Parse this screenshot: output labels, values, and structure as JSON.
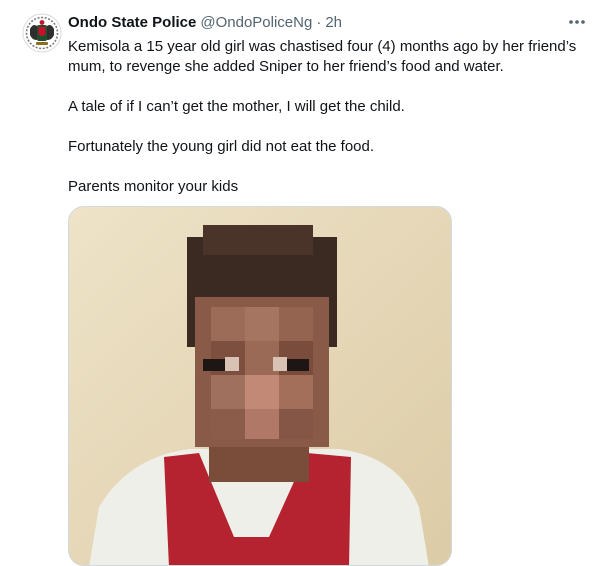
{
  "tweet": {
    "author_name": "Ondo State Police",
    "handle": "@OndoPoliceNg",
    "separator": "·",
    "time": "2h",
    "more_icon": "more-horizontal-icon",
    "avatar_icon": "police-crest-logo",
    "paragraphs": [
      "Kemisola a 15 year old girl was chastised four (4) months ago by her friend’s mum, to revenge she added Sniper to her friend’s food and water.",
      "A tale of if I can’t get the mother, I will get the child.",
      "Fortunately the young girl did not eat the food.",
      "Parents monitor your kids"
    ]
  },
  "colors": {
    "text": "#0f1419",
    "secondary": "#536471",
    "border": "#cfd9de"
  }
}
